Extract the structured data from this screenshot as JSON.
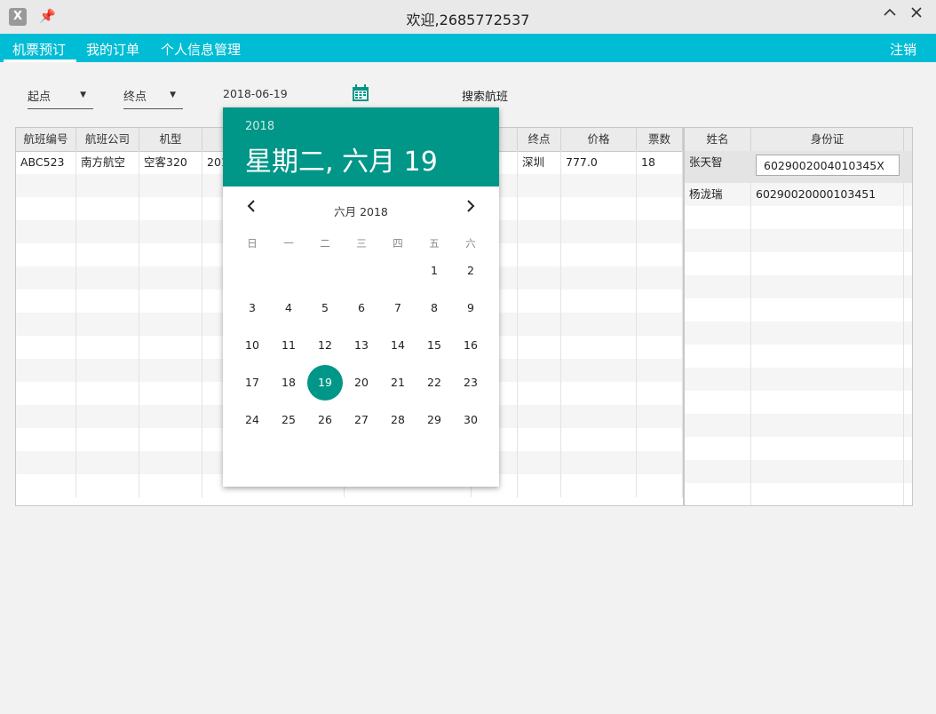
{
  "window": {
    "title": "欢迎,2685772537",
    "app_icon_glyph": "X"
  },
  "menu": {
    "items": [
      "机票预订",
      "我的订单",
      "个人信息管理"
    ],
    "logout": "注销"
  },
  "search": {
    "origin_label": "起点",
    "destination_label": "终点",
    "date_value": "2018-06-19",
    "search_button": "搜索航班"
  },
  "flights": {
    "columns": [
      "航班编号",
      "航班公司",
      "机型",
      "",
      "",
      "点",
      "终点",
      "价格",
      "票数"
    ],
    "rows": [
      [
        "ABC523",
        "南方航空",
        "空客320",
        "201",
        "",
        "",
        "深圳",
        "777.0",
        "18"
      ]
    ]
  },
  "passengers": {
    "columns": [
      "姓名",
      "身份证"
    ],
    "rows": [
      {
        "name": "张天智",
        "id": "6029002004010345X"
      },
      {
        "name": "杨泷瑞",
        "id": "60290020000103451"
      }
    ]
  },
  "date_picker": {
    "year": "2018",
    "header_date": "星期二, 六月 19",
    "month_label": "六月 2018",
    "weekdays": [
      "日",
      "一",
      "二",
      "三",
      "四",
      "五",
      "六"
    ],
    "first_weekday_index": 5,
    "days_in_month": 30,
    "selected_day": 19,
    "accent_color": "#009688"
  },
  "colors": {
    "menubar": "#00bcd4",
    "picker_accent": "#009688"
  }
}
